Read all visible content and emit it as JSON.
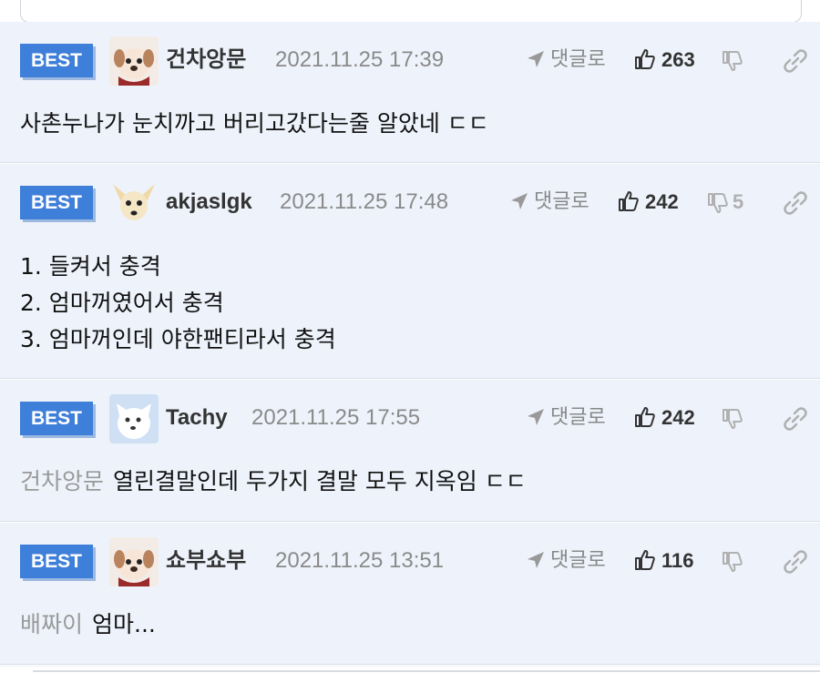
{
  "labels": {
    "best": "BEST",
    "reply": "댓글로"
  },
  "colors": {
    "best_bg": "#3e7fd9",
    "row_bg": "#eef3fb"
  },
  "comments": [
    {
      "avatar": "puppy-avatar",
      "nickname": "건차앙문",
      "date": "2021.11.25 17:39",
      "likes": "263",
      "dislikes": "",
      "lines": [
        "사촌누나가 눈치까고 버리고갔다는줄 알았네 ㄷㄷ"
      ],
      "mention": ""
    },
    {
      "avatar": "chihuahua-avatar",
      "nickname": "akjaslgk",
      "date": "2021.11.25 17:48",
      "likes": "242",
      "dislikes": "5",
      "lines": [
        "1. 들켜서 충격",
        "2. 엄마꺼였어서 충격",
        "3. 엄마꺼인데 야한팬티라서 충격"
      ],
      "mention": ""
    },
    {
      "avatar": "white-dog-avatar",
      "nickname": "Tachy",
      "date": "2021.11.25 17:55",
      "likes": "242",
      "dislikes": "",
      "lines": [
        "열린결말인데 두가지 결말 모두 지옥임 ㄷㄷ"
      ],
      "mention": "건차앙문"
    },
    {
      "avatar": "puppy-avatar",
      "nickname": "쇼부쇼부",
      "date": "2021.11.25 13:51",
      "likes": "116",
      "dislikes": "",
      "lines": [
        "엄마..."
      ],
      "mention": "배짜이"
    }
  ]
}
